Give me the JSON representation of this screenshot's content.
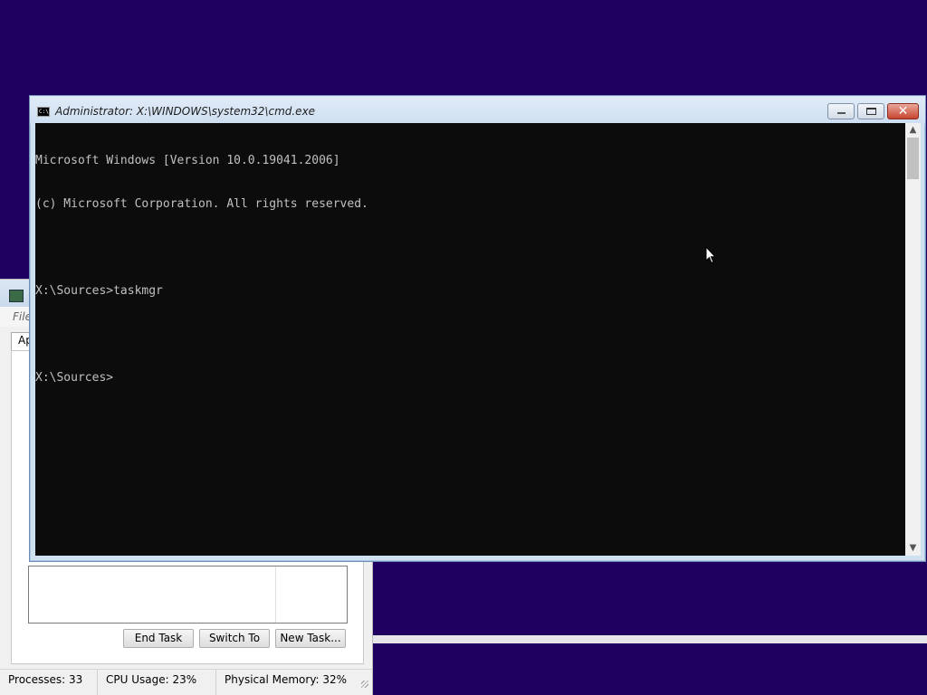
{
  "cmd_window": {
    "title": "Administrator: X:\\WINDOWS\\system32\\cmd.exe",
    "icon_label": "C:\\",
    "close_glyph": "✕",
    "console_lines": [
      "Microsoft Windows [Version 10.0.19041.2006]",
      "(c) Microsoft Corporation. All rights reserved.",
      "",
      "X:\\Sources>taskmgr",
      "",
      "X:\\Sources>"
    ],
    "scroll_up": "▲",
    "scroll_down": "▼"
  },
  "task_manager": {
    "menu_file": "File",
    "tab_applications": "Ap",
    "buttons": {
      "end_task": "End Task",
      "switch_to": "Switch To",
      "new_task": "New Task..."
    },
    "status": {
      "processes": "Processes: 33",
      "cpu_usage": "CPU Usage: 23%",
      "physical_memory": "Physical Memory: 32%"
    }
  },
  "colors": {
    "desktop": "#1f0060",
    "console_bg": "#0c0c0c",
    "console_text": "#c0c0c0"
  }
}
